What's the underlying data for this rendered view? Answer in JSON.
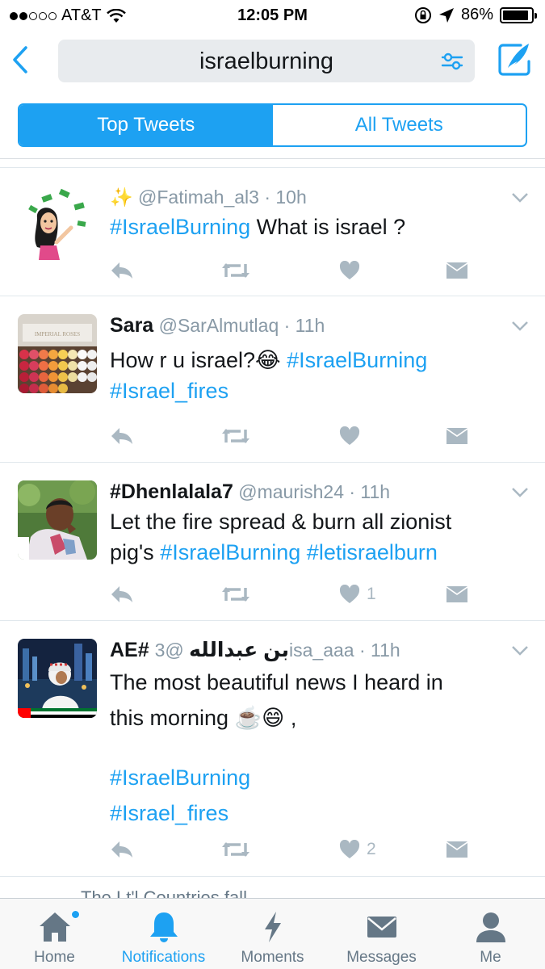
{
  "status_bar": {
    "carrier": "AT&T",
    "time": "12:05 PM",
    "battery": "86%"
  },
  "nav": {
    "search_query": "israelburning"
  },
  "segments": {
    "top": "Top Tweets",
    "all": "All Tweets"
  },
  "tweets": [
    {
      "prefix": "✨",
      "name": "",
      "handle": "@Fatimah_al3",
      "time": "· 10h",
      "text_parts": [
        "#IsraelBurning",
        " What is israel ?"
      ],
      "likes": ""
    },
    {
      "name": "Sara",
      "handle": "@SarAlmutlaq",
      "time": "· 11h",
      "line1": "How r u israel?😂 ",
      "line1_tag": "#IsraelBurning",
      "line2_tag": "#Israel_fires",
      "likes": ""
    },
    {
      "name": "#Dhenlalala7",
      "handle": "@maurish24",
      "time": "· 11h",
      "line1": "Let the fire spread & burn all zionist",
      "line2": "pig's ",
      "line2_tag1": "#IsraelBurning",
      "line2_tag2": " #letisraelburn",
      "likes": "1"
    },
    {
      "name": "AE# بن عبدالله",
      "handle": "@3isa_aaa",
      "time": "· 11h",
      "line1": "The most beautiful news I heard in",
      "line2": "this morning ☕️😄 ,",
      "line3_tag": "#IsraelBurning",
      "line4_tag": "#Israel_fires",
      "likes": "2"
    }
  ],
  "peek_text": "The  Lt'l  Countries  fall",
  "tabs": [
    {
      "label": "Home"
    },
    {
      "label": "Notifications"
    },
    {
      "label": "Moments"
    },
    {
      "label": "Messages"
    },
    {
      "label": "Me"
    }
  ],
  "colors": {
    "accent": "#1da1f2",
    "muted": "#aab8c2",
    "text": "#14171a"
  }
}
